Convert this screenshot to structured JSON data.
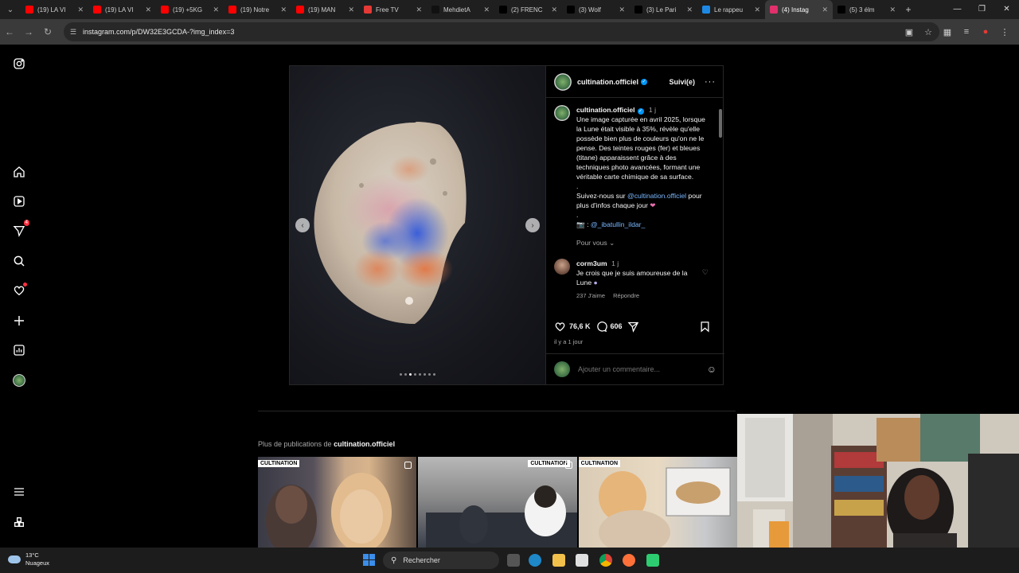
{
  "browser": {
    "tabs": [
      {
        "label": "(19) LA VI",
        "color": "#ff0000"
      },
      {
        "label": "(19) LA VI",
        "color": "#ff0000"
      },
      {
        "label": "(19) +5KG",
        "color": "#ff0000"
      },
      {
        "label": "(19) Notre",
        "color": "#ff0000"
      },
      {
        "label": "(19) MAN",
        "color": "#ff0000"
      },
      {
        "label": "Free TV",
        "color": "#e53935"
      },
      {
        "label": "MehdietA",
        "color": "#111111"
      },
      {
        "label": "(2) FRENC",
        "color": "#000000"
      },
      {
        "label": "(3) Wolf",
        "color": "#000000"
      },
      {
        "label": "(3) Le Pari",
        "color": "#000000"
      },
      {
        "label": "Le rappeu",
        "color": "#1e88e5"
      },
      {
        "label": "(4) Instag",
        "color": "#e1306c"
      },
      {
        "label": "(5) 3 élm",
        "color": "#000000"
      }
    ],
    "url": "instagram.com/p/DW32E3GCDA-?img_index=3"
  },
  "post": {
    "username": "cultination.officiel",
    "follow_label": "Suivi(e)",
    "more_label": "···",
    "caption_time": "1 j",
    "caption_text": "Une image capturée en avril 2025, lorsque la Lune était visible à 35%, révèle qu'elle possède bien plus de couleurs qu'on ne le pense. Des teintes rouges (fer) et bleues (titane) apparaissent grâce à des techniques photo avancées, formant une véritable carte chimique de sa surface.",
    "caption_dot": ".",
    "follow_line_pre": "Suivez-nous sur ",
    "follow_mention": "@cultination.officiel",
    "follow_line_post": "pour plus d'infos chaque jour",
    "credit_dot": ".",
    "credit_prefix": "📷 : ",
    "credit_mention": "@_ibatullin_ildar_",
    "pour_vous": "Pour vous",
    "comment": {
      "user": "corm3um",
      "time": "1 j",
      "text": "Je crois que je suis amoureuse de la Lune",
      "likes": "237 J'aime",
      "reply": "Répondre"
    },
    "likes": "76,6 K",
    "comments_count": "606",
    "date": "il y a 1 jour",
    "add_comment_placeholder": "Ajouter un commentaire...",
    "carousel_count": 8,
    "carousel_active": 2
  },
  "more_posts": {
    "prefix": "Plus de publications de ",
    "user": "cultination.officiel",
    "tag": "CULTINATION"
  },
  "taskbar": {
    "temperature": "13°C",
    "weather": "Nuageux",
    "search": "Rechercher"
  },
  "colors": {
    "accent_blue": "#0095f6",
    "notif_red": "#ff3040"
  }
}
